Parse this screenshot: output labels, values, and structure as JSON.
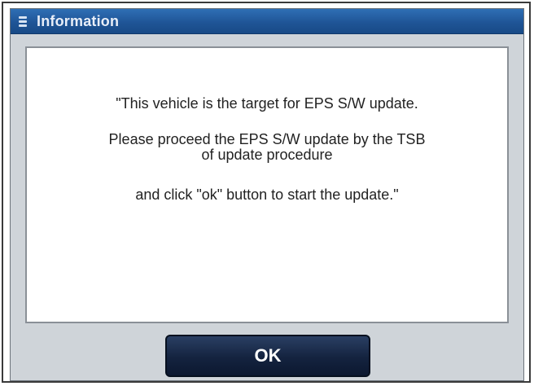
{
  "window": {
    "title": "Information",
    "icon": "menu-icon"
  },
  "message": {
    "line1": "\"This vehicle is the target for EPS S/W update.",
    "line2a": "Please proceed the EPS S/W update by the TSB",
    "line2b": "of update procedure",
    "line3": "and click \"ok\" button to start the update.\""
  },
  "buttons": {
    "ok_label": "OK"
  },
  "colors": {
    "titlebar": "#1f5597",
    "button": "#14233f",
    "dialog_bg": "#cfd4d9"
  }
}
